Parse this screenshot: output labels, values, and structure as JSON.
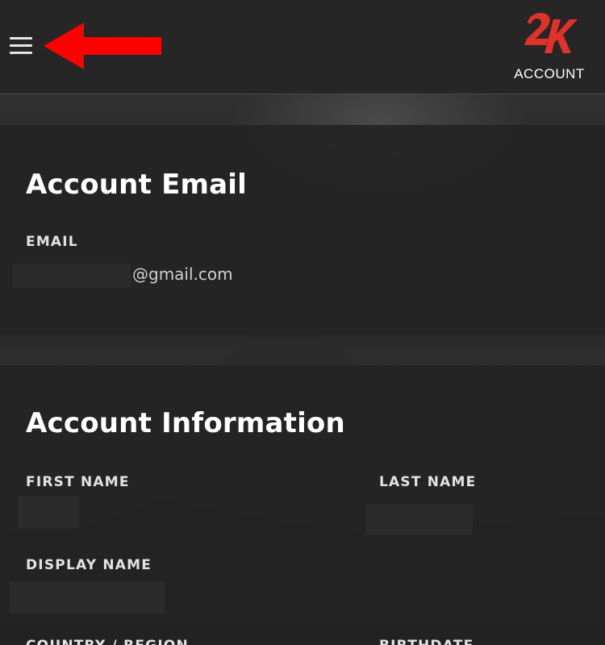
{
  "header": {
    "menu_icon": "hamburger-menu-icon",
    "pointer": "red-arrow-icon",
    "brand": {
      "logo_text": "2K",
      "label": "ACCOUNT",
      "color": "#e0312b"
    }
  },
  "email_section": {
    "title": "Account Email",
    "email_label": "EMAIL",
    "email_value": "@gmail.com"
  },
  "info_section": {
    "title": "Account Information",
    "first_name_label": "FIRST NAME",
    "last_name_label": "LAST NAME",
    "display_name_label": "DISPLAY NAME",
    "country_label": "COUNTRY / REGION",
    "birthdate_label": "BIRTHDATE"
  },
  "colors": {
    "accent_arrow": "#ff0000",
    "background": "#262626",
    "text": "#ffffff"
  }
}
